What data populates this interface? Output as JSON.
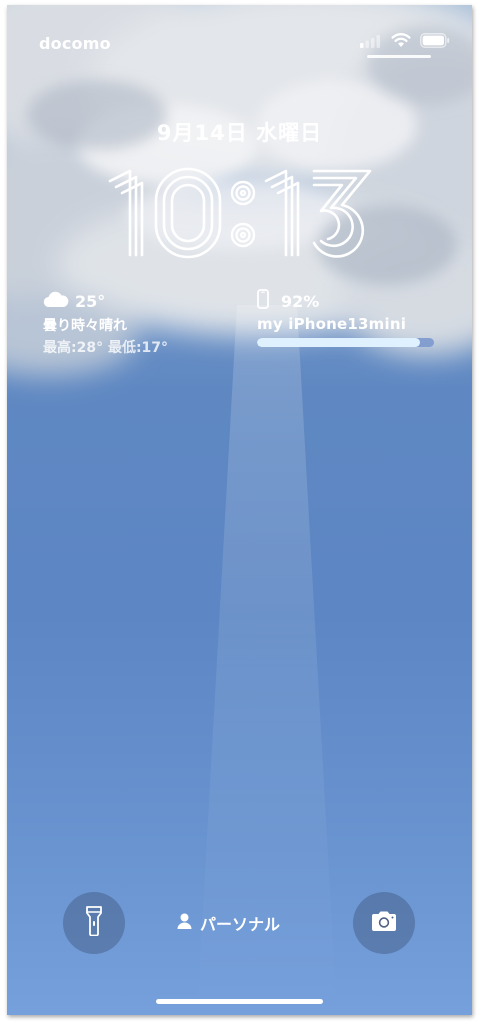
{
  "status_bar": {
    "carrier": "docomo",
    "signal_icon": "cellular-signal-icon",
    "wifi_icon": "wifi-icon",
    "battery_icon": "battery-icon"
  },
  "lock_screen": {
    "date": "9月14日 水曜日",
    "time": "10:13"
  },
  "weather_widget": {
    "icon": "cloud-icon",
    "temperature": "25°",
    "condition": "曇り時々晴れ",
    "high_low": "最高:28° 最低:17°"
  },
  "battery_widget": {
    "icon": "iphone-icon",
    "percent": "92%",
    "device_name": "my iPhone13mini",
    "level": 0.92
  },
  "bottom": {
    "focus_mode": "パーソナル",
    "focus_icon": "person-icon",
    "flashlight_icon": "flashlight-icon",
    "camera_icon": "camera-icon"
  },
  "colors": {
    "sky_top": "#a9bfd8",
    "sky_bottom": "#76a0dc",
    "battery_fill": "#dff1ff"
  }
}
